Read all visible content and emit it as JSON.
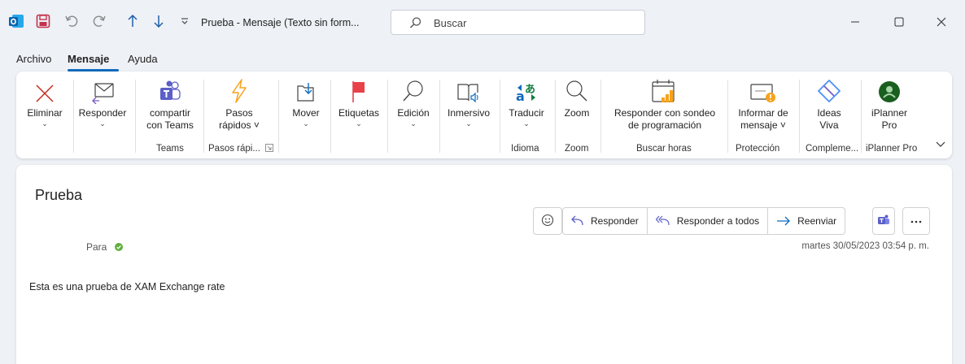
{
  "titlebar": {
    "title": "Prueba  -  Mensaje (Texto sin form...",
    "search_placeholder": "Buscar",
    "icons": [
      "outlook-icon",
      "save-icon",
      "undo-icon",
      "redo-icon",
      "up-arrow-icon",
      "down-arrow-icon",
      "customize-icon"
    ]
  },
  "menu": {
    "items": [
      "Archivo",
      "Mensaje",
      "Ayuda"
    ],
    "active": "Mensaje"
  },
  "ribbon": {
    "buttons": {
      "eliminar": "Eliminar",
      "responder": "Responder",
      "compartir_1": "compartir",
      "compartir_2": "con Teams",
      "pasos_1": "Pasos",
      "pasos_2": "rápidos ˅",
      "mover": "Mover",
      "etiquetas": "Etiquetas",
      "edicion": "Edición",
      "inmersivo": "Inmersivo",
      "traducir": "Traducir",
      "zoom": "Zoom",
      "sondeo_1": "Responder con sondeo",
      "sondeo_2": "de programación",
      "informar_1": "Informar de",
      "informar_2": "mensaje ˅",
      "ideas_1": "Ideas",
      "ideas_2": "Viva",
      "iplanner_1": "iPlanner",
      "iplanner_2": "Pro"
    },
    "groups": {
      "teams": "Teams",
      "pasos": "Pasos rápi...",
      "idioma": "Idioma",
      "zoom": "Zoom",
      "buscar": "Buscar horas",
      "proteccion": "Protección",
      "complementos": "Compleme...",
      "iplanner": "iPlanner Pro"
    }
  },
  "message": {
    "subject": "Prueba",
    "actions": {
      "responder": "Responder",
      "responder_todos": "Responder a todos",
      "reenviar": "Reenviar"
    },
    "to_label": "Para",
    "date": "martes 30/05/2023 03:54 p. m.",
    "body": "Esta es una prueba de XAM Exchange rate"
  },
  "colors": {
    "accent": "#0f6cbd",
    "delete_red": "#c42b1c",
    "teams_purple": "#5b5fc7",
    "flag_red": "#e8414a",
    "bolt_orange": "#f7a21b"
  }
}
